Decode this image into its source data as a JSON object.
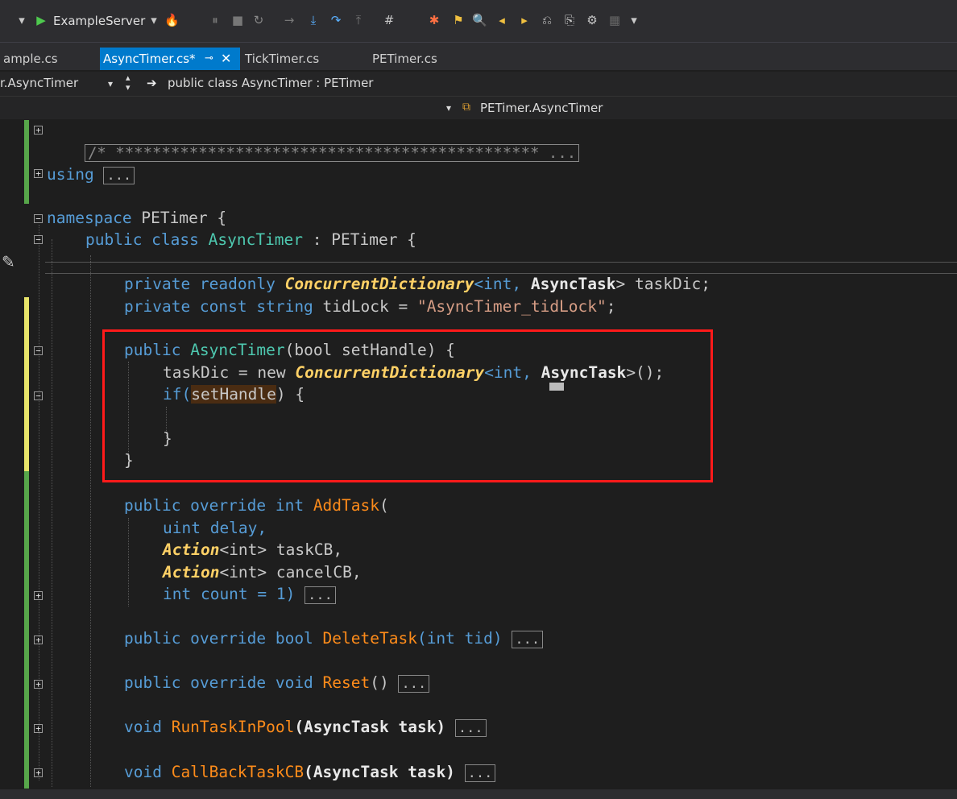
{
  "toolbar": {
    "run_target": "ExampleServer"
  },
  "tabs": [
    {
      "label": "ample.cs"
    },
    {
      "label": "AsyncTimer.cs*"
    },
    {
      "label": "TickTimer.cs"
    },
    {
      "label": "PETimer.cs"
    }
  ],
  "nav": {
    "scope": "r.AsyncTimer",
    "member": "public class AsyncTimer : PETimer",
    "namespace": "PETimer.AsyncTimer"
  },
  "code": {
    "header_comment": "/* ********************************************** ...",
    "using_kw": "using",
    "ellipsis": "...",
    "namespace_kw": "namespace",
    "namespace_name": " PETimer {",
    "class_line": {
      "mod": "public class ",
      "name": "AsyncTimer",
      "rest": " : PETimer {"
    },
    "field1": {
      "mod": "private readonly ",
      "type": "ConcurrentDictionary",
      "rest1": "<int, ",
      "type2": "AsyncTask",
      "rest2": "> taskDic;"
    },
    "field2": {
      "mod": "private const string ",
      "rest": "tidLock = ",
      "str": "\"AsyncTimer_tidLock\"",
      "end": ";"
    },
    "ctor": {
      "mod": "public ",
      "name": "AsyncTimer",
      "rest": "(bool setHandle) {"
    },
    "ctor_body1": {
      "a": "taskDic = new ",
      "type": "ConcurrentDictionary",
      "b": "<int, ",
      "type2": "AsyncTask",
      "c": ">();"
    },
    "ctor_body2": {
      "a": "if(",
      "b": "setHandle",
      "c": ") {"
    },
    "close_inner": "}",
    "close_ctor": "}",
    "addtask": {
      "mod": "public override int ",
      "name": "AddTask",
      "rest": "("
    },
    "param1": "uint delay,",
    "param2": {
      "type": "Action",
      "rest": "<int> taskCB,"
    },
    "param3": {
      "type": "Action",
      "rest": "<int> cancelCB,"
    },
    "param4": "int count = 1) ",
    "deletetask": {
      "mod": "public override bool ",
      "name": "DeleteTask",
      "rest": "(int tid) "
    },
    "reset": {
      "mod": "public override void ",
      "name": "Reset",
      "rest": "() "
    },
    "runtask": {
      "mod": "void ",
      "name": "RunTaskInPool",
      "rest": "(AsyncTask task) "
    },
    "callback": {
      "mod": "void ",
      "name": "CallBackTaskCB",
      "rest": "(AsyncTask task) "
    }
  }
}
